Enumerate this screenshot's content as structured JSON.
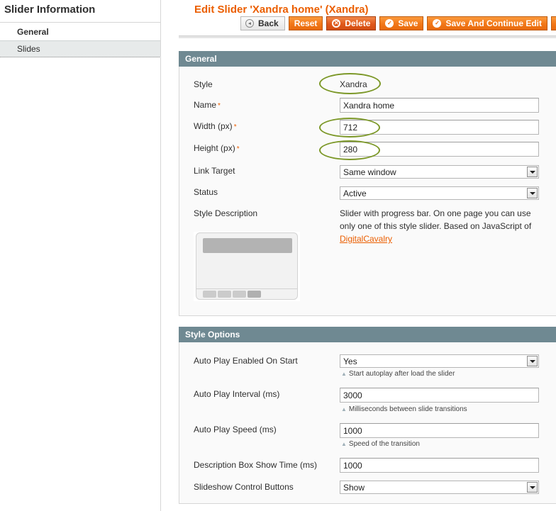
{
  "sidebar": {
    "title": "Slider Information",
    "items": [
      {
        "label": "General",
        "active": true
      },
      {
        "label": "Slides",
        "active": false
      }
    ]
  },
  "header": {
    "title": "Edit Slider 'Xandra home' (Xandra)",
    "buttons": {
      "back": "Back",
      "reset": "Reset",
      "delete": "Delete",
      "save": "Save",
      "save_continue": "Save And Continue Edit"
    },
    "accent_color": "#eb5e00"
  },
  "general": {
    "heading": "General",
    "style": {
      "label": "Style",
      "value": "Xandra"
    },
    "name": {
      "label": "Name",
      "value": "Xandra home",
      "required": "*"
    },
    "width": {
      "label": "Width (px)",
      "value": "712",
      "required": "*"
    },
    "height": {
      "label": "Height (px)",
      "value": "280",
      "required": "*"
    },
    "link_target": {
      "label": "Link Target",
      "value": "Same window"
    },
    "status": {
      "label": "Status",
      "value": "Active"
    },
    "style_description": {
      "label": "Style Description",
      "text": "Slider with progress bar. On one page you can use only one of this style slider. Based on JavaScript of ",
      "link": "DigitalCavalry"
    }
  },
  "style_options": {
    "heading": "Style Options",
    "autoplay_enabled": {
      "label": "Auto Play Enabled On Start",
      "value": "Yes",
      "note": "Start autoplay after load the slider"
    },
    "autoplay_interval": {
      "label": "Auto Play Interval (ms)",
      "value": "3000",
      "note": "Milliseconds between slide transitions"
    },
    "autoplay_speed": {
      "label": "Auto Play Speed (ms)",
      "value": "1000",
      "note": "Speed of the transition"
    },
    "desc_box_time": {
      "label": "Description Box Show Time (ms)",
      "value": "1000"
    },
    "control_buttons": {
      "label": "Slideshow Control Buttons",
      "value": "Show"
    }
  },
  "icons": {
    "back": "◂",
    "delete": "✕",
    "save": "✓",
    "note_triangle": "▲"
  }
}
